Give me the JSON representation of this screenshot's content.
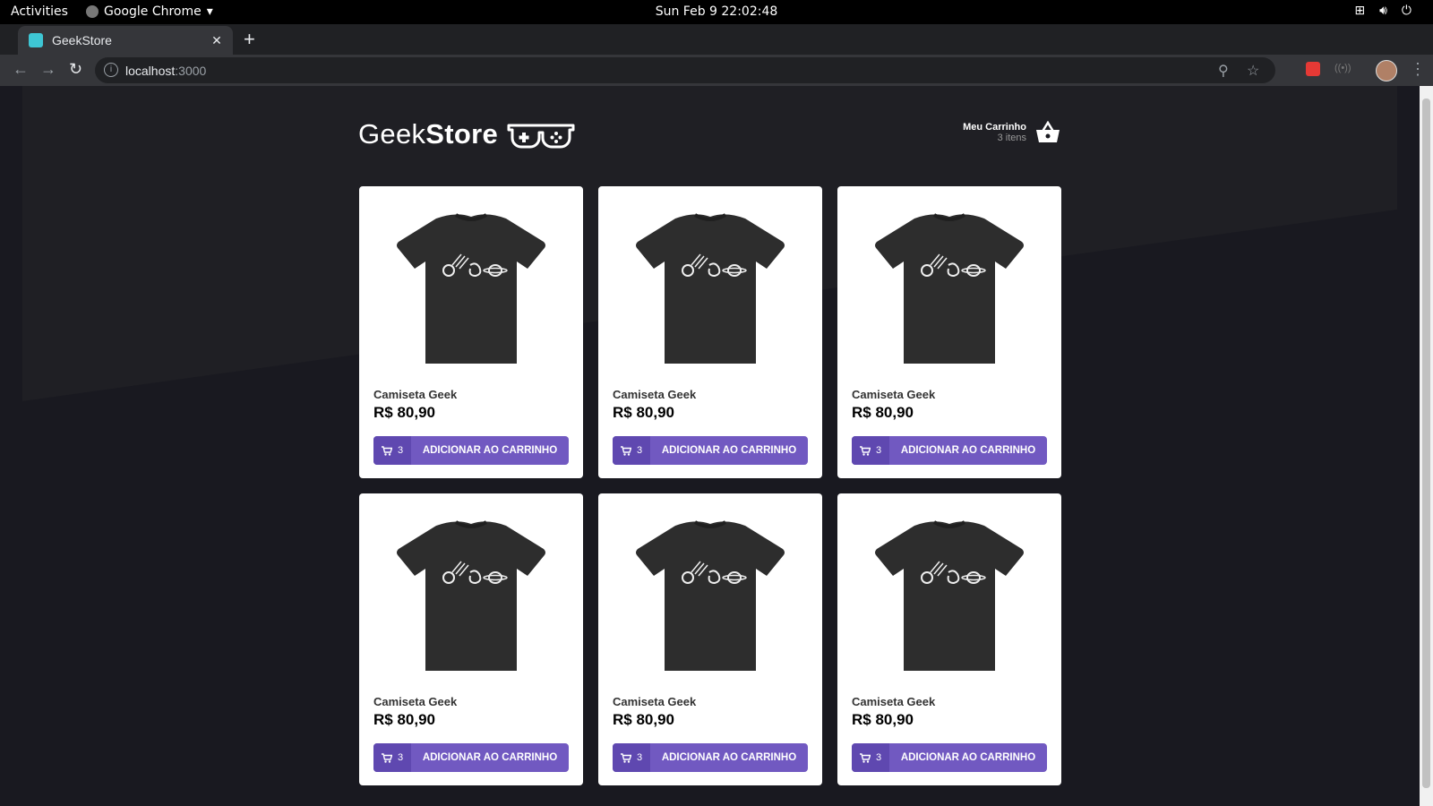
{
  "system_bar": {
    "activities": "Activities",
    "app_name": "Google Chrome",
    "clock": "Sun Feb 9  22:02:48"
  },
  "browser": {
    "tab_title": "GeekStore",
    "url_host": "localhost",
    "url_port": ":3000"
  },
  "store": {
    "logo_light": "Geek",
    "logo_bold": "Store",
    "cart_title": "Meu Carrinho",
    "cart_count": "3 itens"
  },
  "products": [
    {
      "name": "Camiseta Geek",
      "price": "R$ 80,90",
      "qty": "3",
      "button": "ADICIONAR AO CARRINHO"
    },
    {
      "name": "Camiseta Geek",
      "price": "R$ 80,90",
      "qty": "3",
      "button": "ADICIONAR AO CARRINHO"
    },
    {
      "name": "Camiseta Geek",
      "price": "R$ 80,90",
      "qty": "3",
      "button": "ADICIONAR AO CARRINHO"
    },
    {
      "name": "Camiseta Geek",
      "price": "R$ 80,90",
      "qty": "3",
      "button": "ADICIONAR AO CARRINHO"
    },
    {
      "name": "Camiseta Geek",
      "price": "R$ 80,90",
      "qty": "3",
      "button": "ADICIONAR AO CARRINHO"
    },
    {
      "name": "Camiseta Geek",
      "price": "R$ 80,90",
      "qty": "3",
      "button": "ADICIONAR AO CARRINHO"
    }
  ],
  "colors": {
    "background": "#191920",
    "accent": "#7159c1",
    "accent_dark": "#5f48b0"
  }
}
